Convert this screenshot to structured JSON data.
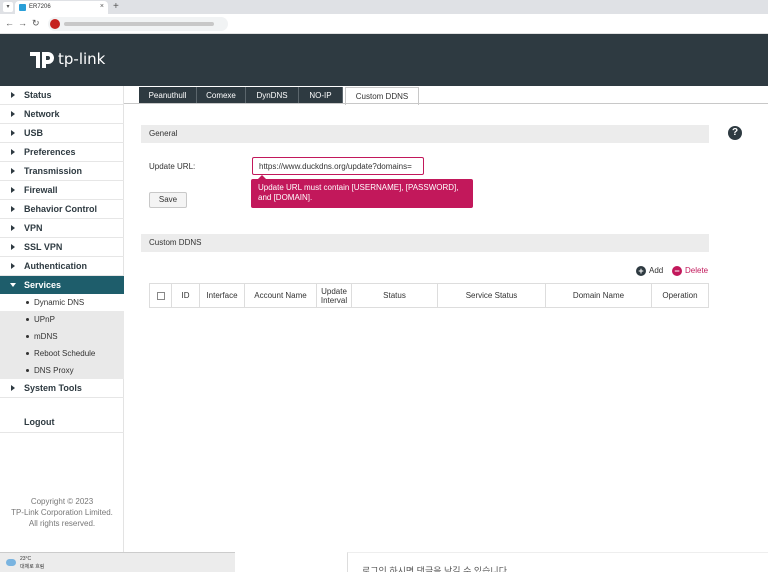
{
  "browser": {
    "tab_title": "ER7206",
    "close": "×",
    "new_tab": "+",
    "back": "←",
    "forward": "→",
    "reload": "↻",
    "dropdown": "▾"
  },
  "header": {
    "logo_text": "tp-link",
    "brand_color": "#2e3a41"
  },
  "sidebar": {
    "items": [
      {
        "label": "Status"
      },
      {
        "label": "Network"
      },
      {
        "label": "USB"
      },
      {
        "label": "Preferences"
      },
      {
        "label": "Transmission"
      },
      {
        "label": "Firewall"
      },
      {
        "label": "Behavior Control"
      },
      {
        "label": "VPN"
      },
      {
        "label": "SSL VPN"
      },
      {
        "label": "Authentication"
      },
      {
        "label": "Services",
        "active": true
      },
      {
        "label": "System Tools"
      }
    ],
    "sub_items": [
      {
        "label": "Dynamic DNS",
        "selected": true
      },
      {
        "label": "UPnP"
      },
      {
        "label": "mDNS"
      },
      {
        "label": "Reboot Schedule"
      },
      {
        "label": "DNS Proxy"
      }
    ],
    "logout": "Logout",
    "copyright": [
      "Copyright © 2023",
      "TP-Link Corporation Limited.",
      "All rights reserved."
    ]
  },
  "tabs": [
    "Peanuthull",
    "Comexe",
    "DynDNS",
    "NO-IP",
    "Custom DDNS"
  ],
  "general": {
    "section_title": "General",
    "update_url_label": "Update URL:",
    "update_url_value": "https://www.duckdns.org/update?domains=",
    "tooltip": "Update URL must contain [USERNAME], [PASSWORD], and [DOMAIN].",
    "save_label": "Save",
    "error_color": "#c2185b"
  },
  "custom_ddns": {
    "section_title": "Custom DDNS",
    "add_label": "Add",
    "delete_label": "Delete",
    "columns": [
      "ID",
      "Interface",
      "Account Name",
      "Update Interval",
      "Status",
      "Service Status",
      "Domain Name",
      "Operation"
    ]
  },
  "help_icon": "?",
  "taskbar": {
    "temperature": "23°C",
    "weather": "대체로 흐림"
  },
  "bottom_note": "로그인 하시면 댓글을 남길 수 있습니다"
}
